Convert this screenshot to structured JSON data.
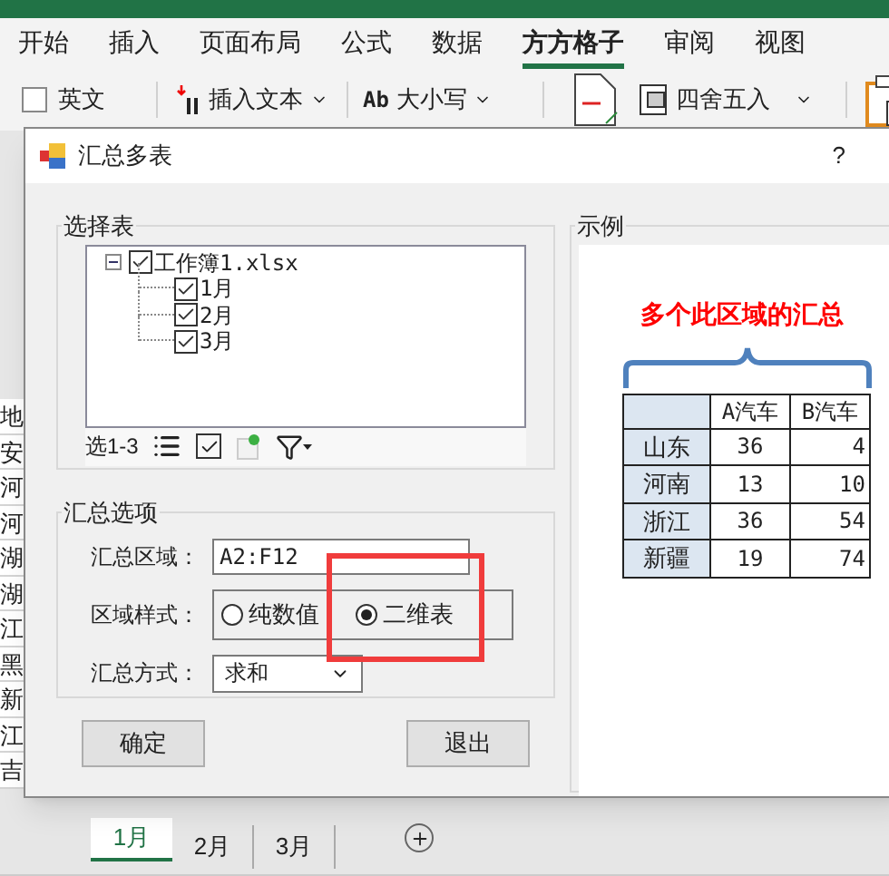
{
  "ribbon_tabs": [
    {
      "label": "开始",
      "selected": false
    },
    {
      "label": "插入",
      "selected": false
    },
    {
      "label": "页面布局",
      "selected": false
    },
    {
      "label": "公式",
      "selected": false
    },
    {
      "label": "数据",
      "selected": false
    },
    {
      "label": "方方格子",
      "selected": true
    },
    {
      "label": "审阅",
      "selected": false
    },
    {
      "label": "视图",
      "selected": false
    }
  ],
  "ribbon_tools": [
    {
      "kind": "checkbox",
      "label": "英文",
      "checked": false
    },
    {
      "kind": "insert",
      "label": "插入文本"
    },
    {
      "kind": "case",
      "prefix": "Ab",
      "label": "大小写"
    },
    {
      "kind": "round",
      "label": "四舍五入"
    }
  ],
  "sheet_column": [
    "地",
    "安",
    "河",
    "河",
    "湖",
    "湖",
    "江",
    "黑",
    "新",
    "江",
    "吉"
  ],
  "dialog": {
    "title": "汇总多表",
    "help": "?",
    "select_group": {
      "title": "选择表",
      "tree": [
        {
          "label": "工作簿1.xlsx",
          "checked": true,
          "expanded": true,
          "children": [
            {
              "label": "1月",
              "checked": true
            },
            {
              "label": "2月",
              "checked": true
            },
            {
              "label": "3月",
              "checked": true
            }
          ]
        }
      ],
      "selection_label": "选1-3"
    },
    "options_group": {
      "title": "汇总选项",
      "range_label": "汇总区域：",
      "range_value": "A2:F12",
      "style_label": "区域样式：",
      "styles": [
        {
          "label": "纯数值",
          "selected": false
        },
        {
          "label": "二维表",
          "selected": true
        }
      ],
      "method_label": "汇总方式：",
      "method_value": "求和"
    },
    "example": {
      "title": "示例",
      "caption": "多个此区域的汇总",
      "columns": [
        "A汽车",
        "B汽车"
      ],
      "rows": [
        {
          "name": "山东",
          "values": [
            "36",
            "4"
          ]
        },
        {
          "name": "河南",
          "values": [
            "13",
            "10"
          ]
        },
        {
          "name": "浙江",
          "values": [
            "36",
            "54"
          ]
        },
        {
          "name": "新疆",
          "values": [
            "19",
            "74"
          ]
        }
      ]
    },
    "buttons": [
      "确定",
      "退出"
    ]
  },
  "sheet_tabs": [
    {
      "label": "1月",
      "selected": true
    },
    {
      "label": "2月",
      "selected": false
    },
    {
      "label": "3月",
      "selected": false
    }
  ]
}
